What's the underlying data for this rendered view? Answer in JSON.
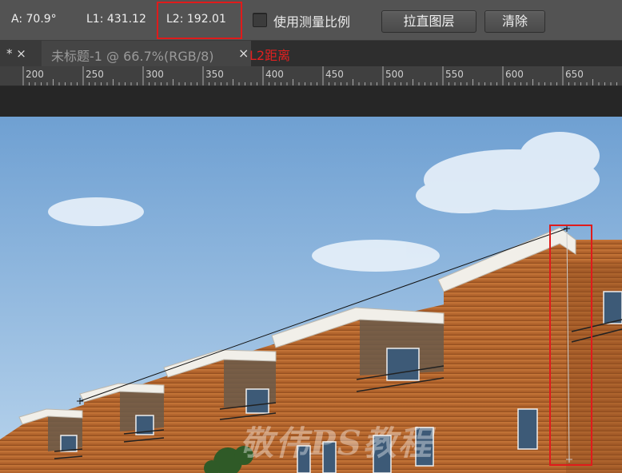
{
  "options_bar": {
    "angle": "A: 70.9°",
    "l1": "L1: 431.12",
    "l2": "L2: 192.01",
    "use_scale_label": "使用测量比例",
    "straighten_button": "拉直图层",
    "clear_button": "清除"
  },
  "tabs": {
    "prev_tab_label": "* ×",
    "current_tab_title": "未标题-1 @ 66.7%(RGB/8)",
    "close_symbol": "×"
  },
  "annotation": "L2距离",
  "ruler": {
    "labels": [
      "200",
      "250",
      "300",
      "350",
      "400",
      "450",
      "500",
      "550",
      "600",
      "650"
    ]
  },
  "watermark": "敬伟PS教程",
  "colors": {
    "highlight": "#e01b1b",
    "brick": "#b8652a",
    "sky": "#8fb8de"
  }
}
